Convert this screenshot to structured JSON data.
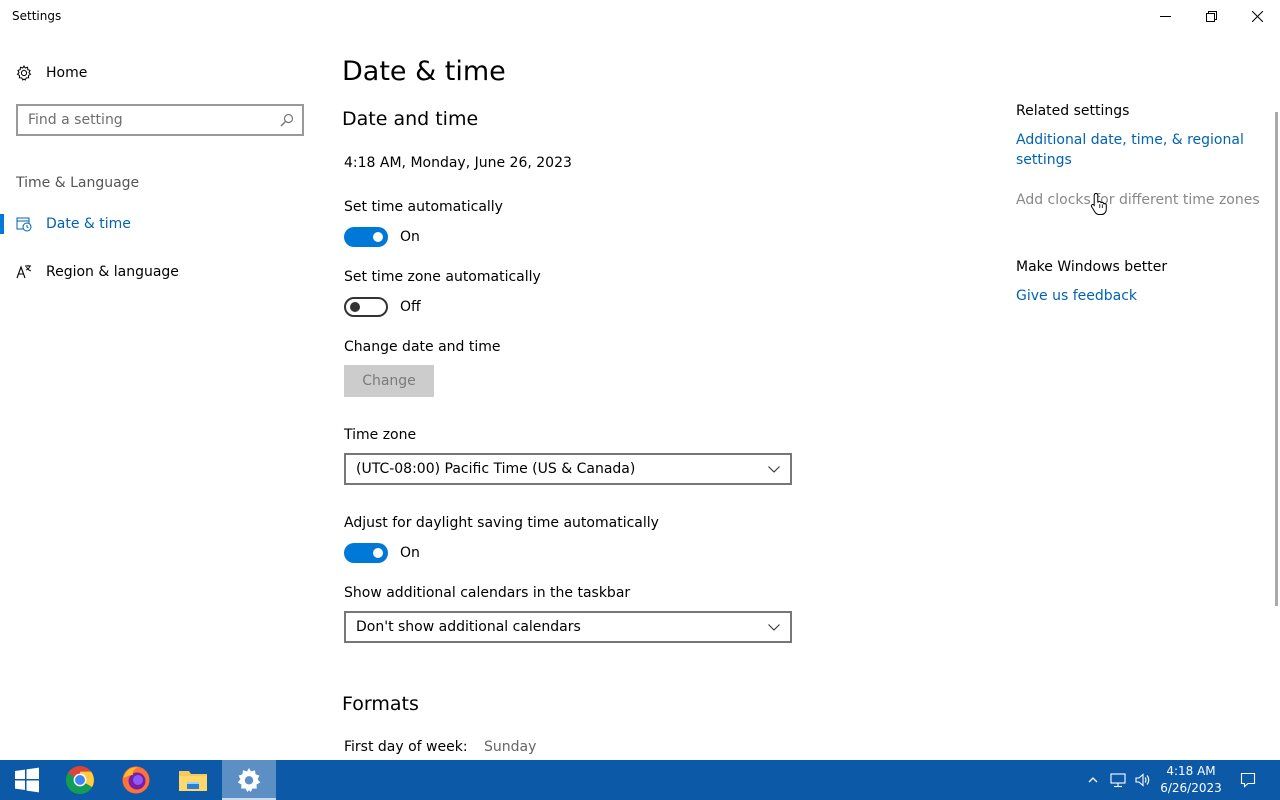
{
  "window": {
    "title": "Settings"
  },
  "sidebar": {
    "home": "Home",
    "search_placeholder": "Find a setting",
    "section": "Time & Language",
    "items": [
      {
        "label": "Date & time",
        "icon": "calendar-clock-icon",
        "active": true
      },
      {
        "label": "Region & language",
        "icon": "language-icon",
        "active": false
      }
    ]
  },
  "main": {
    "page_title": "Date & time",
    "section_title": "Date and time",
    "current_datetime": "4:18 AM, Monday, June 26, 2023",
    "set_time_auto": {
      "label": "Set time automatically",
      "state": "On"
    },
    "set_tz_auto": {
      "label": "Set time zone automatically",
      "state": "Off"
    },
    "change_date": {
      "label": "Change date and time",
      "button": "Change"
    },
    "timezone": {
      "label": "Time zone",
      "value": "(UTC-08:00) Pacific Time (US & Canada)"
    },
    "dst": {
      "label": "Adjust for daylight saving time automatically",
      "state": "On"
    },
    "calendars": {
      "label": "Show additional calendars in the taskbar",
      "value": "Don't show additional calendars"
    },
    "formats_title": "Formats",
    "first_day": {
      "label": "First day of week:",
      "value": "Sunday"
    }
  },
  "related": {
    "title": "Related settings",
    "link_additional": "Additional date, time, & regional settings",
    "link_clocks": "Add clocks for different time zones",
    "better_title": "Make Windows better",
    "link_feedback": "Give us feedback"
  },
  "taskbar": {
    "apps": [
      "start-icon",
      "chrome-icon",
      "firefox-icon",
      "file-explorer-icon",
      "settings-icon"
    ],
    "time": "4:18 AM",
    "date": "6/26/2023"
  },
  "colors": {
    "accent": "#0078d7",
    "link": "#0063b1",
    "taskbar": "#0c59a7"
  }
}
